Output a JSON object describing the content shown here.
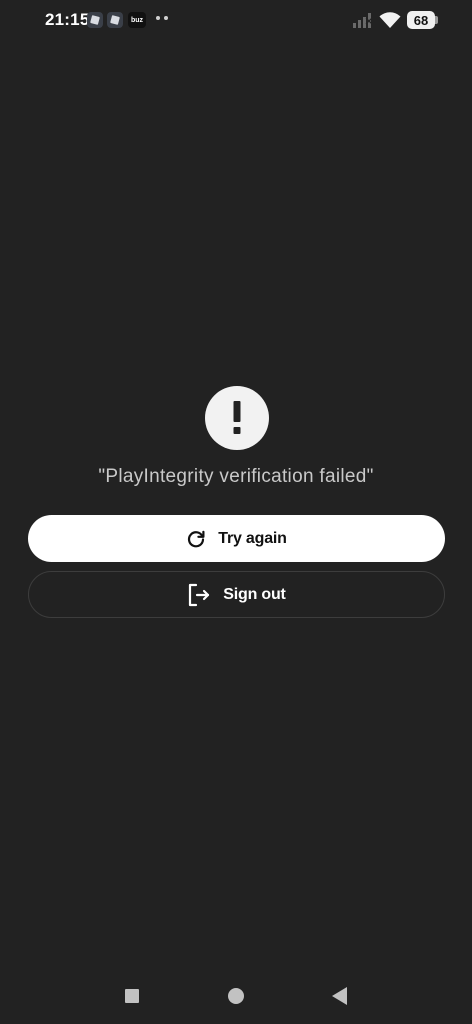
{
  "status_bar": {
    "time": "21:15",
    "buzz_label": "buz",
    "battery_level": "68"
  },
  "alert": {
    "icon": "exclamation-icon",
    "message": "\"PlayIntegrity verification failed\""
  },
  "actions": {
    "try_again_label": "Try again",
    "try_again_icon": "refresh-icon",
    "sign_out_label": "Sign out",
    "sign_out_icon": "sign-out-icon"
  },
  "nav_bar": {
    "recents_icon": "square-icon",
    "home_icon": "circle-icon",
    "back_icon": "triangle-back-icon"
  },
  "colors": {
    "background": "#222222",
    "primary_button": "#ffffff",
    "message_text": "#c9c9c9"
  }
}
